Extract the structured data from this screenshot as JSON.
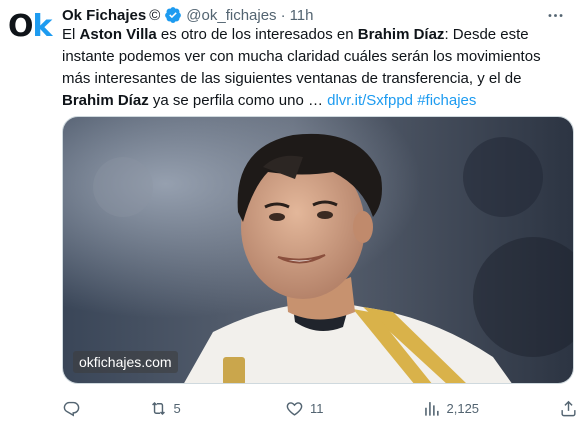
{
  "author": {
    "avatar_letters": "Ok",
    "name": "Ok Fichajes",
    "copyright_symbol": "©",
    "handle": "@ok_fichajes",
    "separator": "·",
    "time": "11h",
    "verified": true
  },
  "tweet": {
    "p1": "El ",
    "b1": "Aston Villa",
    "p2": " es otro de los interesados en ",
    "b2": "Brahim Díaz",
    "p3": ": Desde este instante podemos ver con mucha claridad cuáles serán los movimientos más interesantes de las siguientes ventanas de transferencia, y el de ",
    "b3": "Brahim Díaz",
    "p4": " ya se perfila como uno … ",
    "link": "dlvr.it/Sxfppd",
    "hashtag": "#fichajes"
  },
  "media": {
    "watermark": "okfichajes.com"
  },
  "actions": {
    "replies": "",
    "retweets": "5",
    "likes": "11",
    "views": "2,125"
  },
  "colors": {
    "accent": "#1d9bf0",
    "text": "#0f1419",
    "secondary": "#536471"
  }
}
